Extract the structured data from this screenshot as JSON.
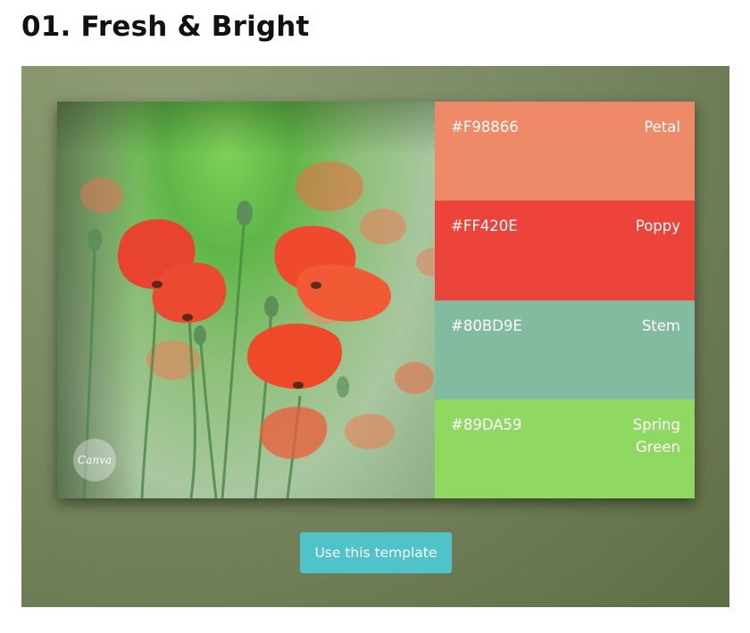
{
  "header": {
    "title": "01. Fresh & Bright"
  },
  "template_card": {
    "image_badge": "Canva",
    "palette": [
      {
        "hex": "#F98866",
        "name": "Petal",
        "color": "#ef8a68"
      },
      {
        "hex": "#FF420E",
        "name": "Poppy",
        "color": "#ec433b"
      },
      {
        "hex": "#80BD9E",
        "name": "Stem",
        "color": "#82bb9f"
      },
      {
        "hex": "#89DA59",
        "name": "Spring Green",
        "color": "#8fd962"
      }
    ]
  },
  "actions": {
    "use_template_label": "Use this template"
  },
  "colors": {
    "stage_background": "#7a8a62",
    "button": "#4fc3c9"
  }
}
